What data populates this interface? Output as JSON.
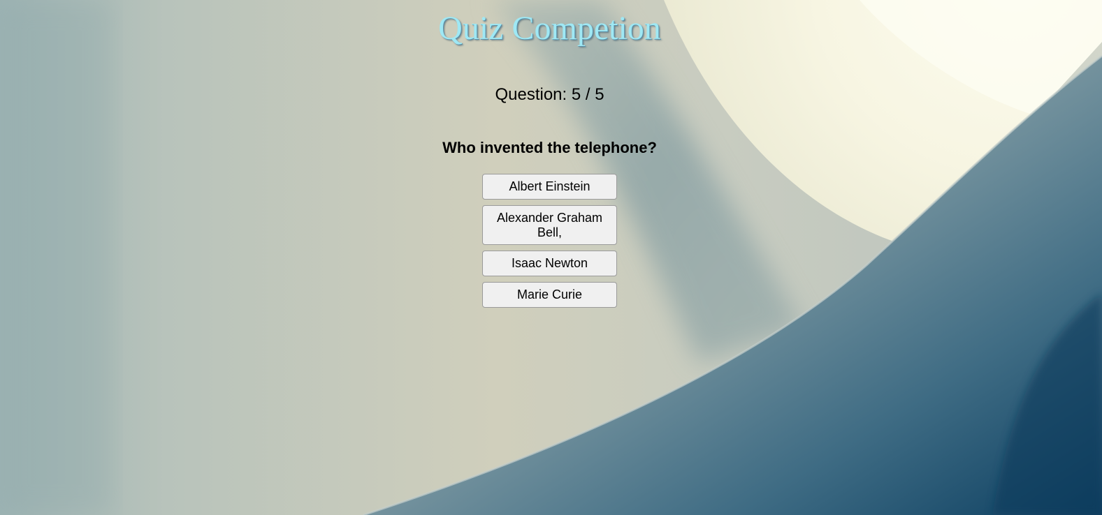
{
  "quiz": {
    "title": "Quiz Competion",
    "counter": "Question: 5 / 5",
    "question": "Who invented the telephone?",
    "answers": [
      "Albert Einstein",
      "Alexander Graham Bell,",
      "Isaac Newton",
      "Marie Curie"
    ]
  },
  "colors": {
    "title": "#9fe8f4",
    "button_bg": "#f0f0f0",
    "button_border": "#9a9a9a"
  }
}
